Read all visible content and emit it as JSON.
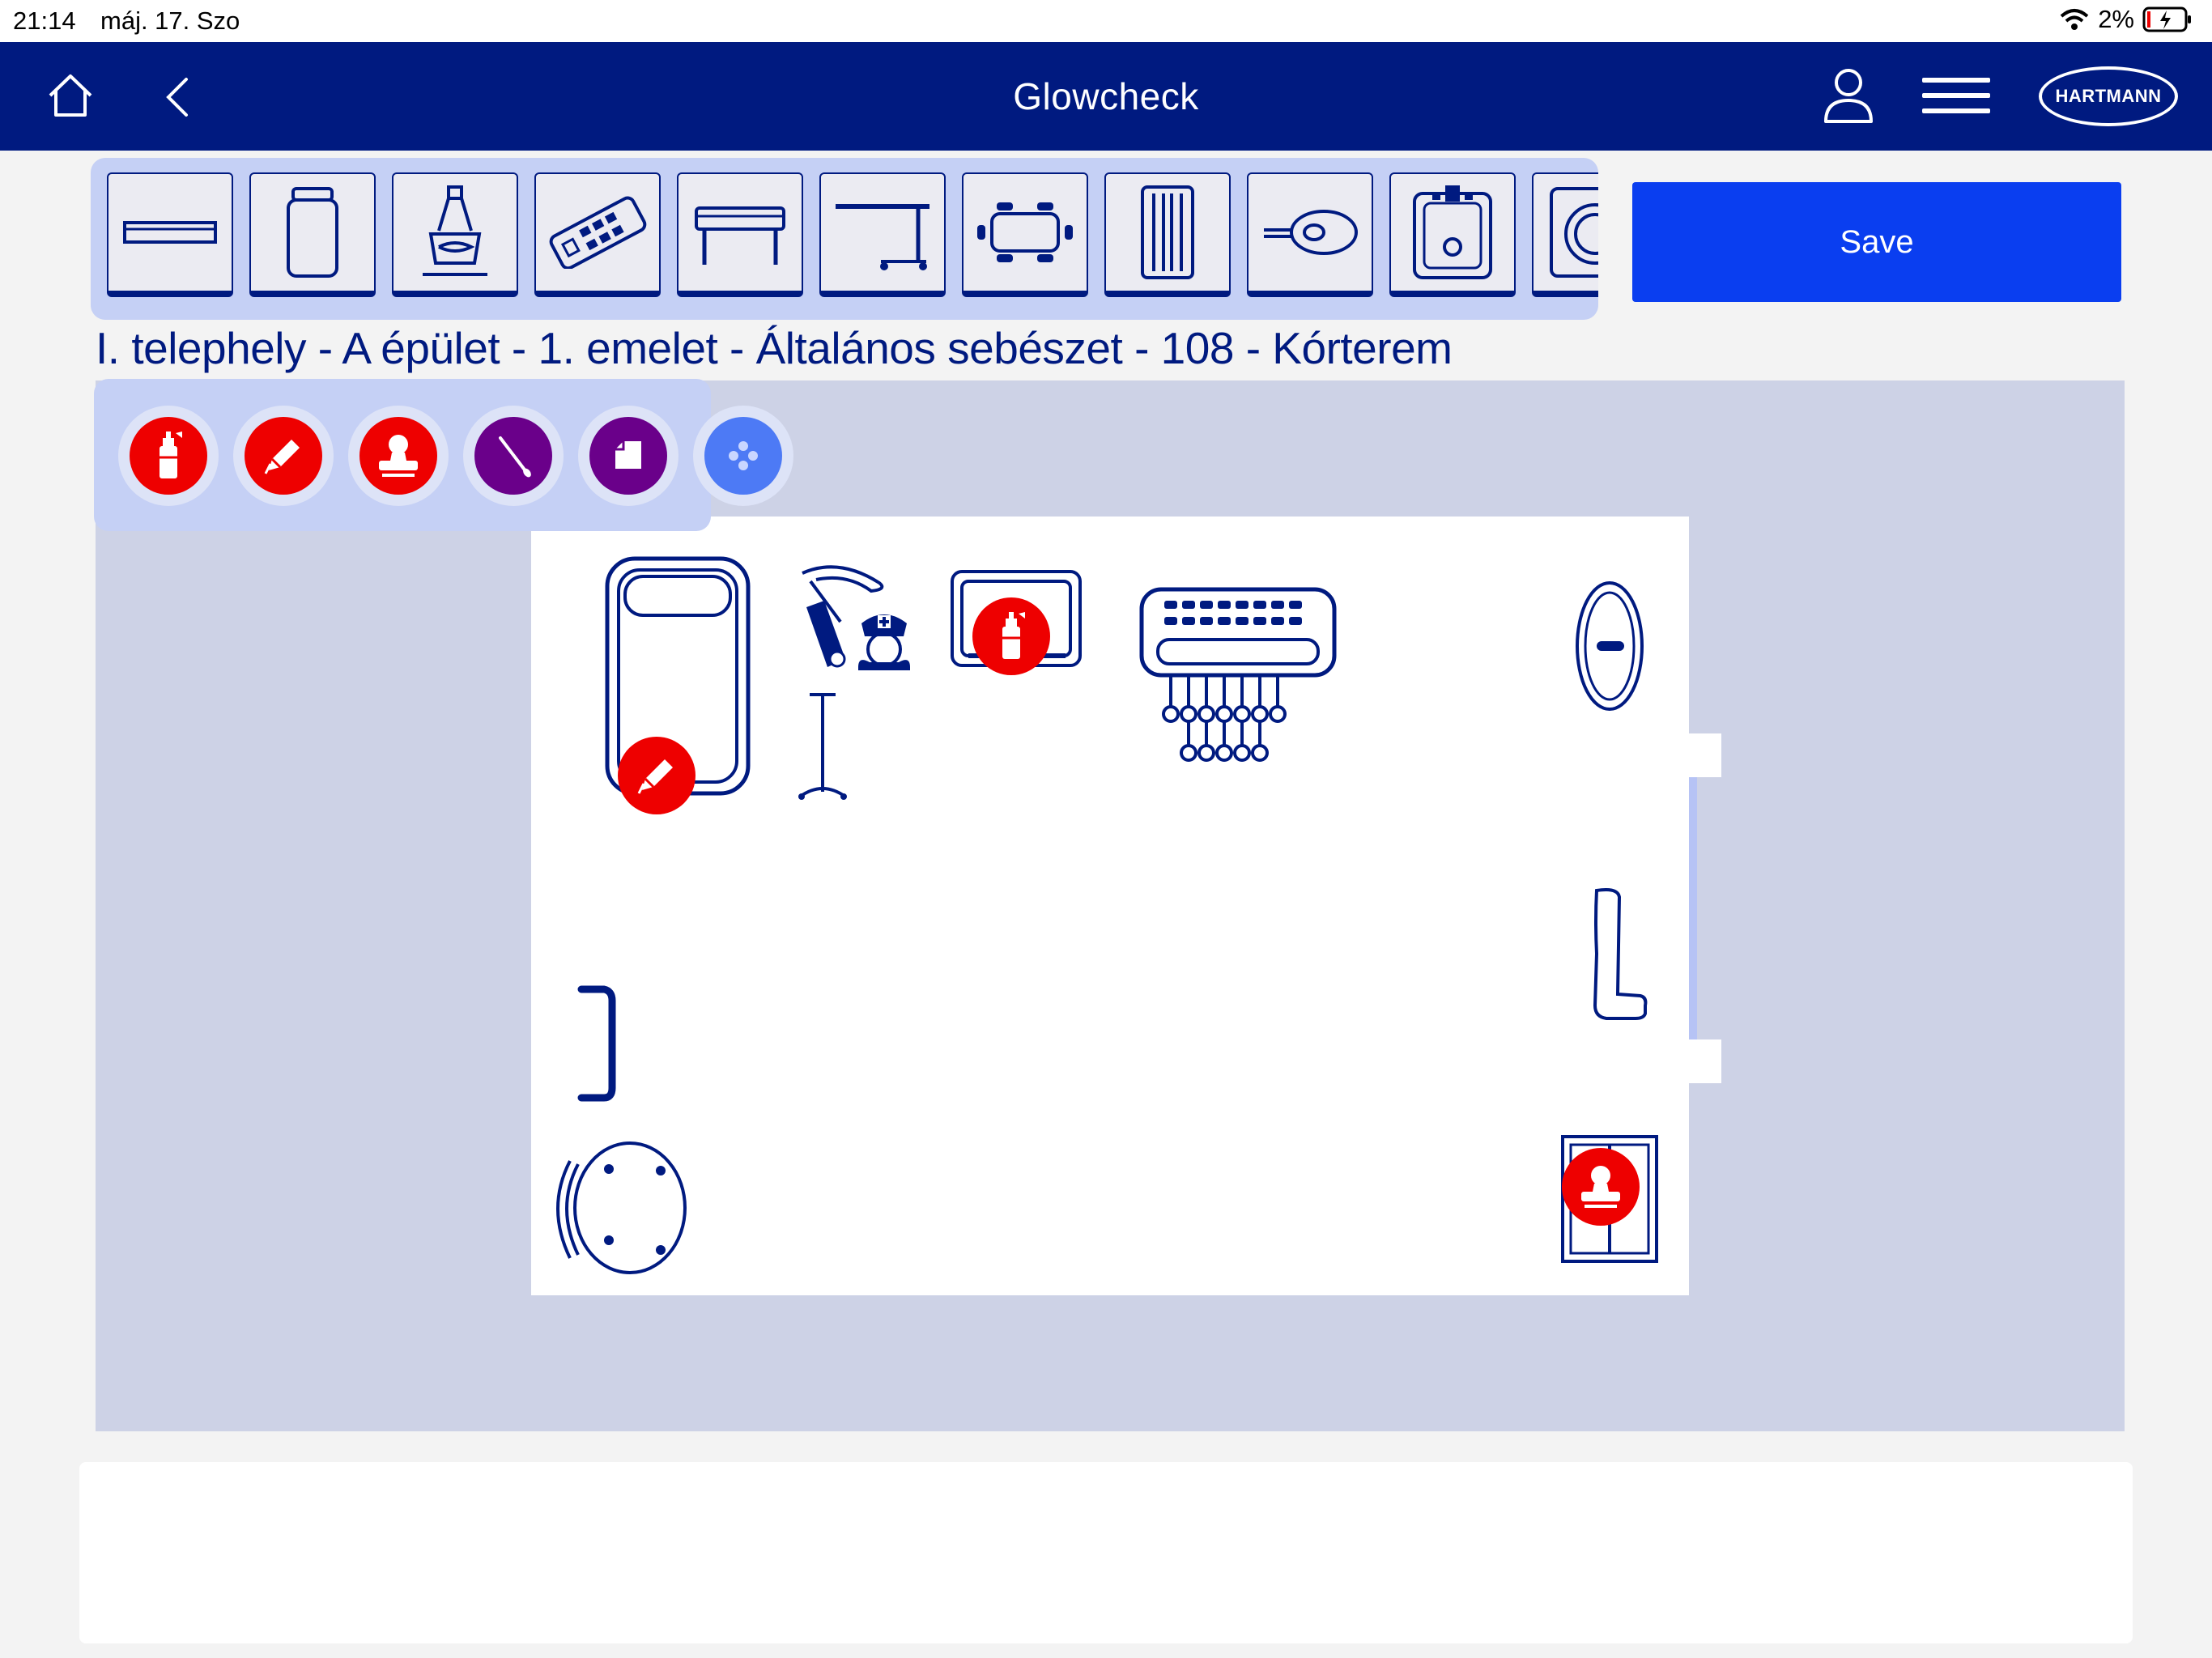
{
  "status_bar": {
    "time": "21:14",
    "date": "máj. 17. Szo",
    "battery": "2%"
  },
  "nav": {
    "title": "Glowcheck",
    "logo_text": "HARTMANN",
    "icons": [
      "home-icon",
      "back-icon",
      "user-icon",
      "menu-icon"
    ]
  },
  "palette": {
    "items": [
      "shelf-icon",
      "container-icon",
      "faucet-icon",
      "remote-control-icon",
      "bench-icon",
      "trolley-table-icon",
      "dining-table-icon",
      "radiator-icon",
      "hand-dryer-icon",
      "sink-icon",
      "washer-icon"
    ]
  },
  "save_label": "Save",
  "breadcrumb": "I. telephely - A épület - 1. emelet - Általános sebészet - 108 - Kórterem",
  "tools": [
    {
      "icon": "spray-icon",
      "color": "#ee0000"
    },
    {
      "icon": "pencil-icon",
      "color": "#ee0000"
    },
    {
      "icon": "stamp-icon",
      "color": "#ee0000"
    },
    {
      "icon": "swab-icon",
      "color": "#6a008a"
    },
    {
      "icon": "wipe-icon",
      "color": "#6a008a"
    },
    {
      "icon": "dots-icon",
      "color": "#4d7af5"
    }
  ],
  "colors": {
    "nav_blue": "#001a80",
    "save_blue": "#0a3ef0",
    "marker_red": "#ee0000"
  }
}
